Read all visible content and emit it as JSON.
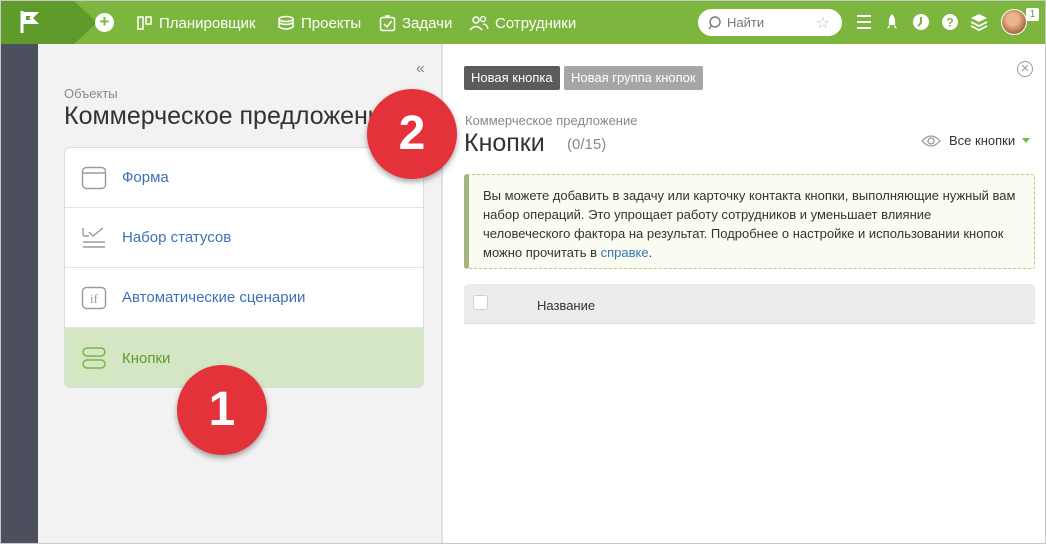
{
  "nav": {
    "items": [
      {
        "label": "Планировщик",
        "icon": "planner-icon"
      },
      {
        "label": "Проекты",
        "icon": "projects-icon"
      },
      {
        "label": "Задачи",
        "icon": "tasks-icon"
      },
      {
        "label": "Сотрудники",
        "icon": "users-icon"
      }
    ],
    "search_placeholder": "Найти",
    "notification_count": "1"
  },
  "left": {
    "breadcrumb": "Объекты",
    "title": "Коммерческое предложение",
    "items": [
      {
        "label": "Форма",
        "icon": "form-icon",
        "active": false
      },
      {
        "label": "Набор статусов",
        "icon": "status-set-icon",
        "active": false
      },
      {
        "label": "Автоматические сценарии",
        "icon": "if-script-icon",
        "active": false
      },
      {
        "label": "Кнопки",
        "icon": "buttons-icon",
        "active": true
      }
    ]
  },
  "right": {
    "btn_new": "Новая кнопка",
    "btn_group": "Новая группа кнопок",
    "breadcrumb": "Коммерческое предложение",
    "title": "Кнопки",
    "count": "(0/15)",
    "filter_label": "Все кнопки",
    "info_text": "Вы можете добавить в задачу или карточку контакта кнопки, выполняющие нужный вам набор операций. Это упрощает работу сотрудников и уменьшает влияние человеческого фактора на результат. Подробнее о настройке и использовании кнопок можно прочитать в ",
    "info_link": "справке",
    "info_end": ".",
    "table_header_name": "Название"
  },
  "callouts": {
    "one": "1",
    "two": "2"
  },
  "colors": {
    "brand_green": "#7cb63f",
    "dark_green": "#5f9b2b",
    "link_blue": "#3a73b5",
    "callout_red": "#e3323a"
  }
}
